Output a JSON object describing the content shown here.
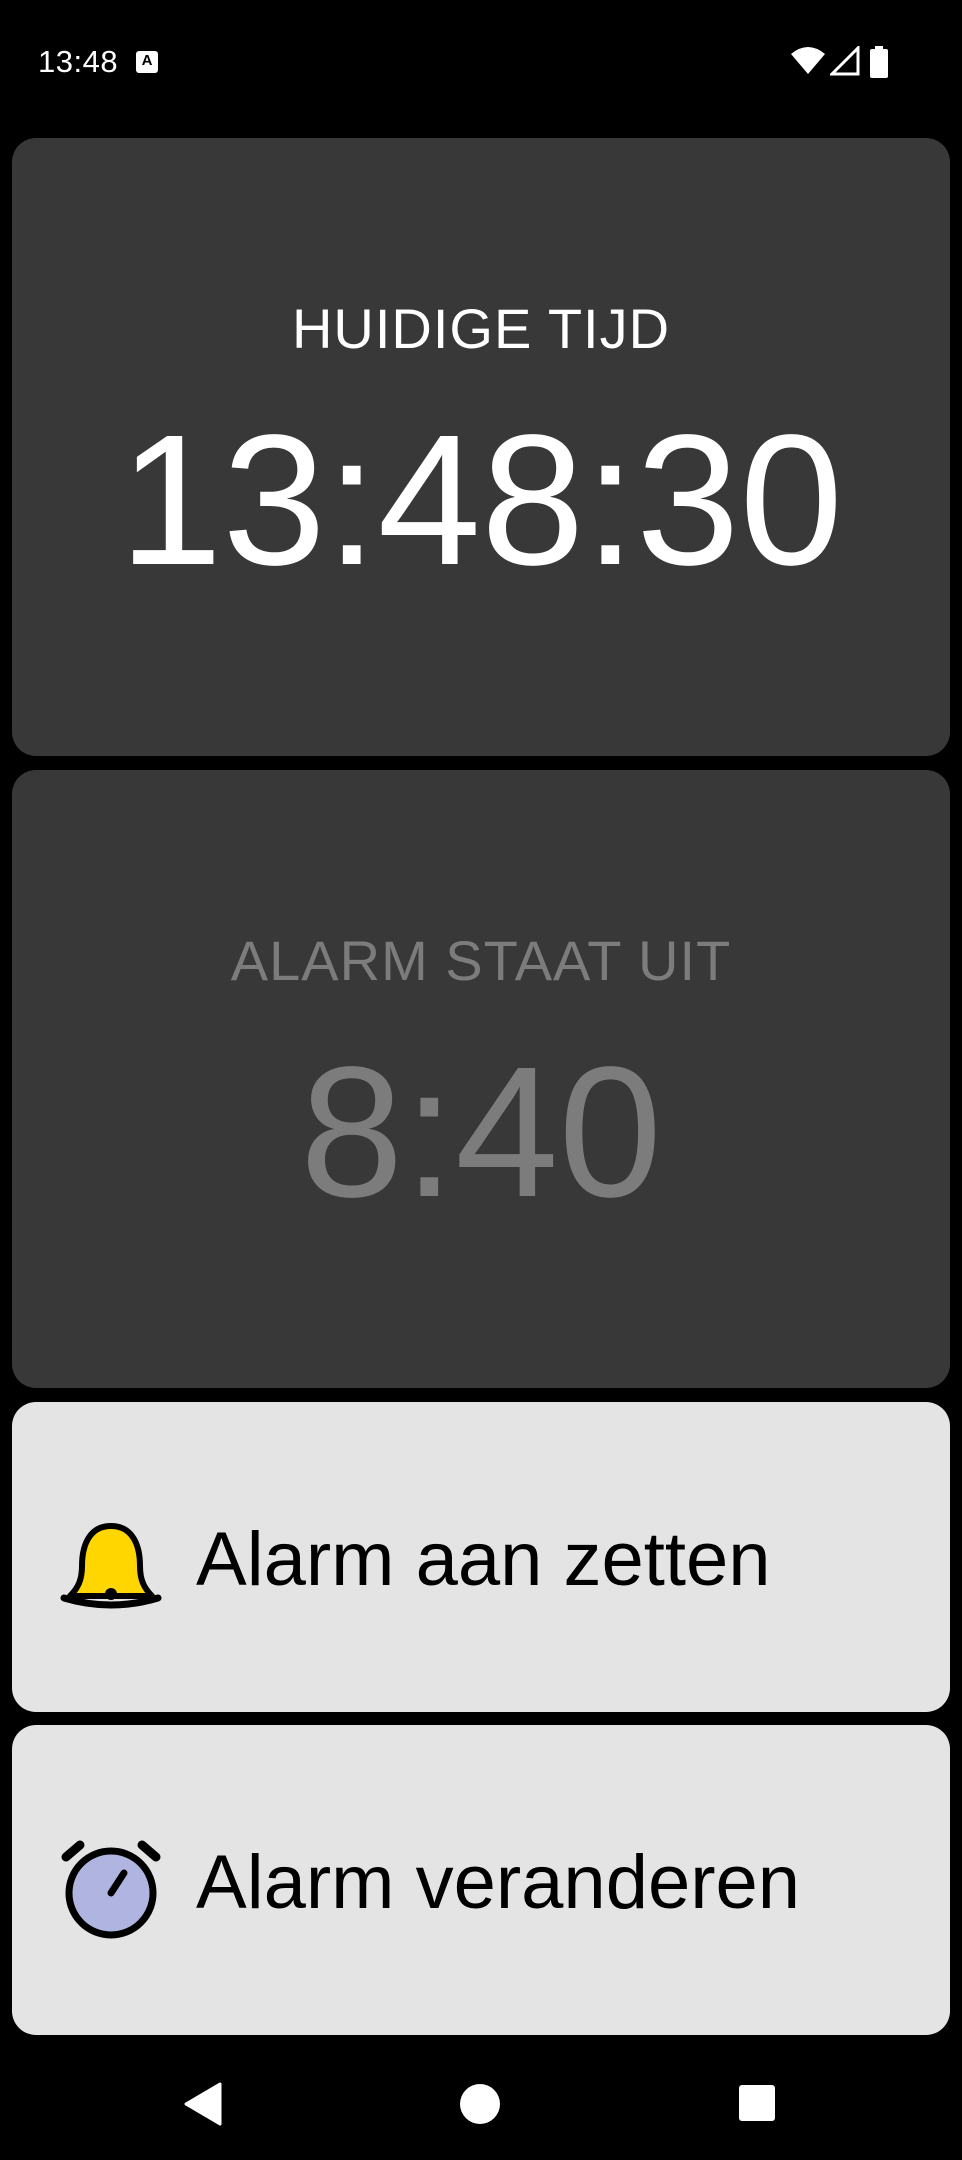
{
  "status_bar": {
    "time": "13:48",
    "icons": [
      "a-notification-icon",
      "wifi-icon",
      "signal-icon",
      "battery-icon"
    ]
  },
  "current_time": {
    "label": "HUIDIGE TIJD",
    "value": "13:48:30"
  },
  "alarm": {
    "status_label": "ALARM STAAT UIT",
    "time": "8:40",
    "enabled": false
  },
  "buttons": {
    "alarm_on_label": "Alarm aan zetten",
    "alarm_change_label": "Alarm veranderen"
  },
  "icons": {
    "bell": "bell-icon",
    "alarm_clock": "alarm-clock-icon"
  },
  "colors": {
    "panel_dark": "#383838",
    "panel_light": "#e4e4e4",
    "bell_yellow": "#ffd600",
    "clock_face": "#b0b4e0",
    "disabled_text": "#7c7c7c"
  },
  "nav_bar": {
    "buttons": [
      "back",
      "home",
      "recents"
    ]
  }
}
